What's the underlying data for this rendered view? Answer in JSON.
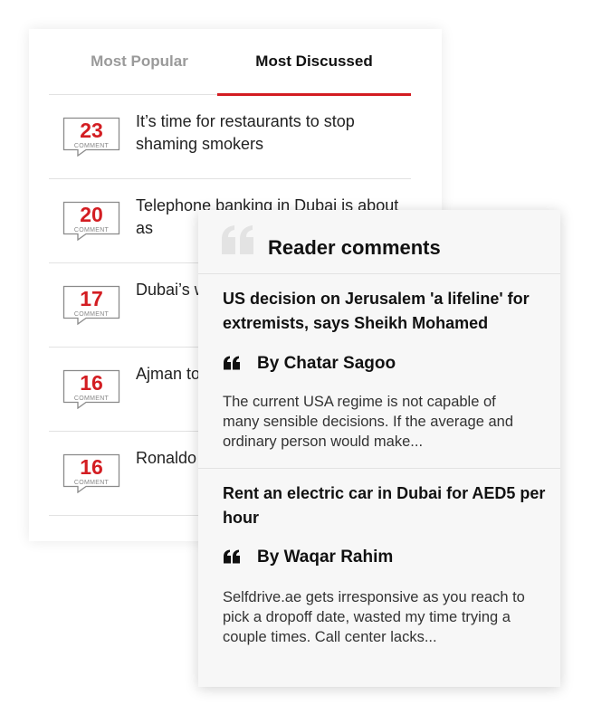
{
  "tabs": [
    {
      "label": "Most Popular",
      "active": false
    },
    {
      "label": "Most Discussed",
      "active": true
    }
  ],
  "comment_badge_label": "COMMENT",
  "articles": [
    {
      "count": "23",
      "title": "It’s time for restaurants to stop shaming smokers"
    },
    {
      "count": "20",
      "title": "Telephone banking in Dubai is about as"
    },
    {
      "count": "17",
      "title": "Dubai’s with res"
    },
    {
      "count": "16",
      "title": "Ajman to estate p"
    },
    {
      "count": "16",
      "title": "Ronaldo created"
    }
  ],
  "reader_comments": {
    "title": "Reader comments",
    "items": [
      {
        "article": "US decision on Jerusalem 'a lifeline' for extremists, says Sheikh Mohamed",
        "author": "By Chatar Sagoo",
        "excerpt": "The current USA regime is not capable of many sensible decisions. If the average and ordinary person would make..."
      },
      {
        "article": "Rent an electric car in Dubai for AED5 per hour",
        "author": "By Waqar Rahim",
        "excerpt": "Selfdrive.ae gets irresponsive as you reach to pick a dropoff date, wasted my time trying a couple times. Call center lacks..."
      }
    ]
  },
  "colors": {
    "accent": "#d31d22",
    "inactive_tab": "#9a9a9a",
    "quote_icon_light": "#e3e3e3",
    "quote_icon_dark": "#111111"
  }
}
